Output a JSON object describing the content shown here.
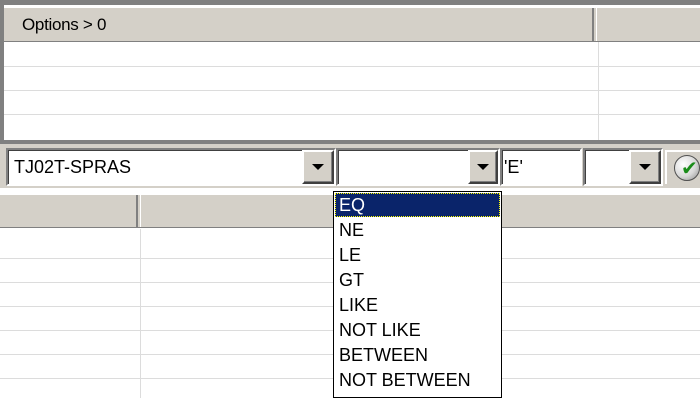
{
  "top_grid": {
    "header_label": "Options > 0"
  },
  "filter_bar": {
    "field_value": "TJ02T-SPRAS",
    "operator_value": "",
    "compare_value": "'E'",
    "extra_value": ""
  },
  "operator_dropdown": {
    "selected": "EQ",
    "options": [
      "EQ",
      "NE",
      "LE",
      "GT",
      "LIKE",
      "NOT LIKE",
      "BETWEEN",
      "NOT BETWEEN"
    ]
  },
  "icons": {
    "apply": "check-icon",
    "dropdown_arrow": "chevron-down-icon"
  },
  "colors": {
    "selection": "#0a246a",
    "face": "#d4d0c8",
    "check_green": "#1a8c1a"
  }
}
